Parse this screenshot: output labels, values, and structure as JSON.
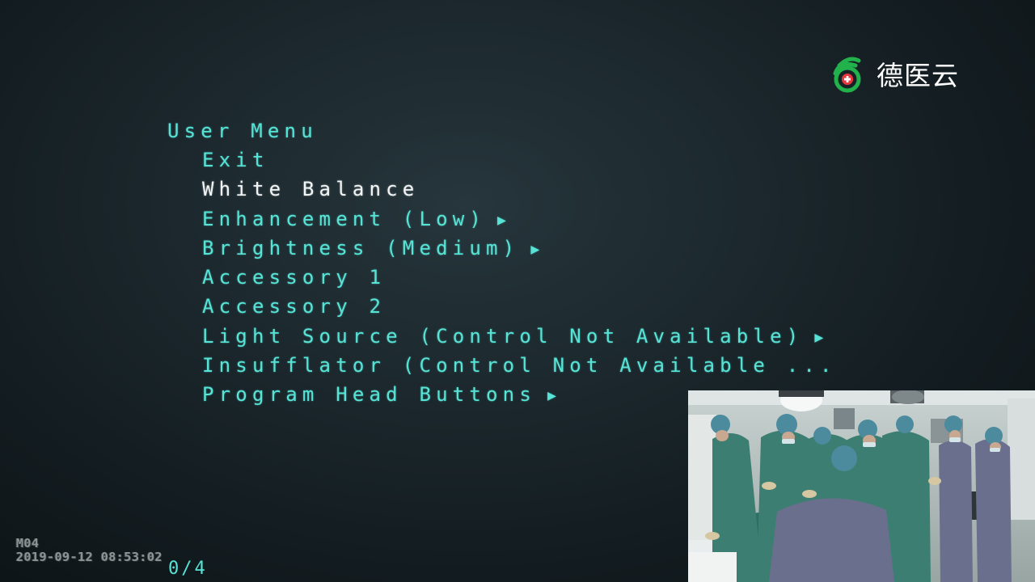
{
  "brand": {
    "name": "德医云",
    "logo_icon": "deyiyun-logo-icon",
    "colors": {
      "green": "#22b24c",
      "red": "#e8383d"
    }
  },
  "menu": {
    "title": "User Menu",
    "items": [
      {
        "label": "Exit",
        "submenu": false
      },
      {
        "label": "White Balance",
        "submenu": false
      },
      {
        "label": "Enhancement (Low)",
        "submenu": true
      },
      {
        "label": "Brightness (Medium)",
        "submenu": true
      },
      {
        "label": "Accessory 1",
        "submenu": false
      },
      {
        "label": "Accessory 2",
        "submenu": false
      },
      {
        "label": "Light Source (Control Not Available)",
        "submenu": true
      },
      {
        "label": "Insufflator (Control Not Available ...",
        "submenu": false
      },
      {
        "label": "Program Head Buttons",
        "submenu": true
      }
    ],
    "selected_index": 1,
    "arrow_glyph": "▶",
    "colors": {
      "item": "#57e3d6",
      "selected": "#f2f6f6"
    }
  },
  "osd": {
    "mode": "M04",
    "datetime": "2019-09-12 08:53:02"
  },
  "page_counter": "0/4",
  "inset_video": {
    "icon": "operating-room-video-feed"
  }
}
